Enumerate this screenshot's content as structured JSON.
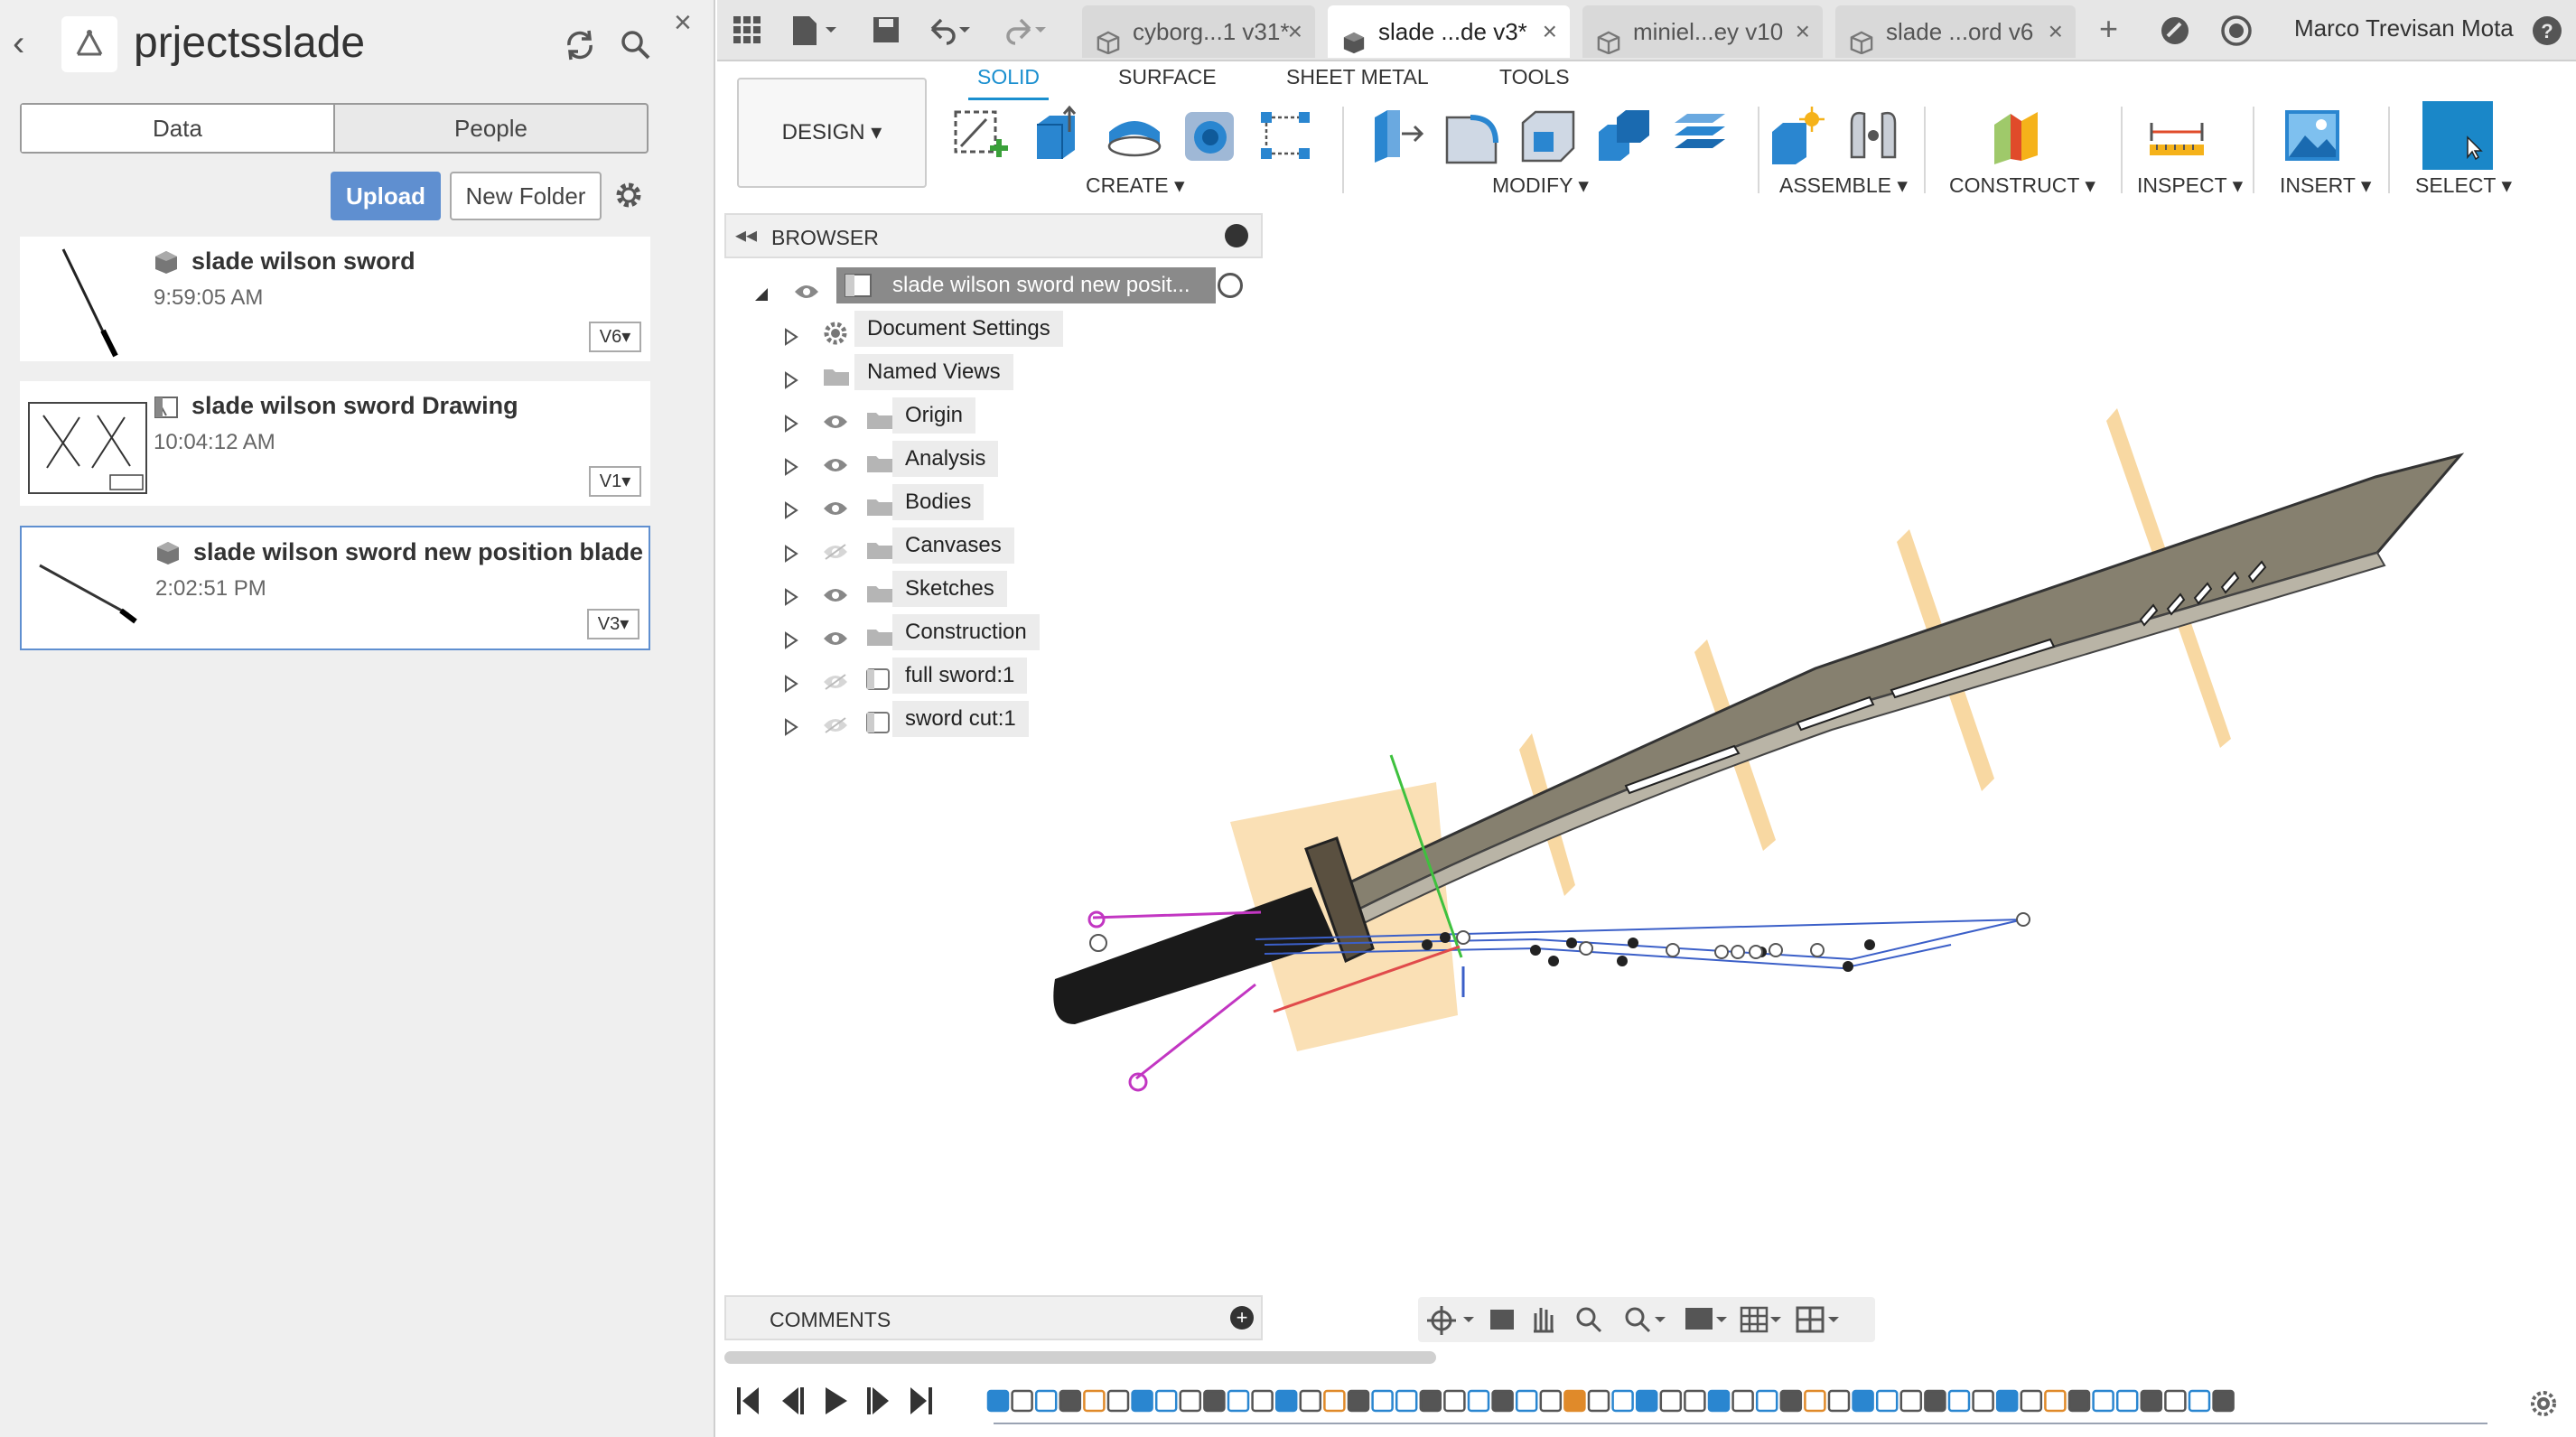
{
  "panel": {
    "project_title": "prjectsslade",
    "tabs": [
      "Data",
      "People"
    ],
    "upload_label": "Upload",
    "new_folder_label": "New Folder",
    "files": [
      {
        "name": "slade wilson sword",
        "time": "9:59:05 AM",
        "version": "V6"
      },
      {
        "name": "slade wilson sword Drawing",
        "time": "10:04:12 AM",
        "version": "V1"
      },
      {
        "name": "slade wilson sword new position blade",
        "time": "2:02:51 PM",
        "version": "V3"
      }
    ]
  },
  "topbar": {
    "tabs": [
      {
        "label": "cyborg...1 v31*",
        "active": false
      },
      {
        "label": "slade ...de v3*",
        "active": true
      },
      {
        "label": "miniel...ey v10",
        "active": false
      },
      {
        "label": "slade ...ord v6",
        "active": false
      }
    ],
    "user_name": "Marco Trevisan Mota",
    "help_label": "?"
  },
  "ribbon": {
    "workspace": "DESIGN",
    "tabs": [
      "SOLID",
      "SURFACE",
      "SHEET METAL",
      "TOOLS"
    ],
    "groups": [
      "CREATE",
      "MODIFY",
      "ASSEMBLE",
      "CONSTRUCT",
      "INSPECT",
      "INSERT",
      "SELECT"
    ]
  },
  "browser": {
    "title": "BROWSER",
    "root": "slade wilson sword new posit...",
    "items": [
      {
        "label": "Document Settings",
        "kind": "settings",
        "eye": "none"
      },
      {
        "label": "Named Views",
        "kind": "folder",
        "eye": "none"
      },
      {
        "label": "Origin",
        "kind": "folder",
        "eye": "visible"
      },
      {
        "label": "Analysis",
        "kind": "folder",
        "eye": "visible"
      },
      {
        "label": "Bodies",
        "kind": "folder",
        "eye": "visible"
      },
      {
        "label": "Canvases",
        "kind": "folder",
        "eye": "hidden"
      },
      {
        "label": "Sketches",
        "kind": "folder",
        "eye": "visible"
      },
      {
        "label": "Construction",
        "kind": "folder",
        "eye": "visible"
      },
      {
        "label": "full sword:1",
        "kind": "component",
        "eye": "hidden"
      },
      {
        "label": "sword cut:1",
        "kind": "component",
        "eye": "hidden"
      }
    ]
  },
  "comments": {
    "title": "COMMENTS"
  },
  "colors": {
    "accent": "#1a8fcf",
    "upload": "#5f8fd0",
    "plane": "#f5c77a"
  }
}
